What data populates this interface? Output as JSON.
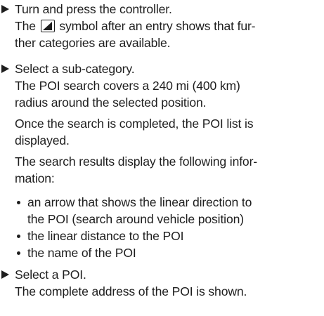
{
  "steps": [
    {
      "instruction": "Turn and press the controller.",
      "detail_before": "The",
      "detail_after": "symbol after an entry shows that fur-",
      "detail_line2": "ther categories are available.",
      "symbol_icon": "submenu-triangle-icon"
    },
    {
      "instruction": "Select a sub-category.",
      "detail_line1": "The POI search covers a 240 mi (400 km)",
      "detail_line2": "radius around the selected position.",
      "para2_line1": "Once the search is completed, the POI list is",
      "para2_line2": "displayed.",
      "para3_line1": "The search results display the following infor-",
      "para3_line2": "mation:",
      "bullets": [
        {
          "line1": "an arrow that shows the linear direction to",
          "line2": "the POI (search around vehicle position)"
        },
        {
          "line1": "the linear distance to the POI"
        },
        {
          "line1": "the name of the POI"
        }
      ]
    },
    {
      "instruction": "Select a POI.",
      "detail_line1": "The complete address of the POI is shown."
    }
  ]
}
